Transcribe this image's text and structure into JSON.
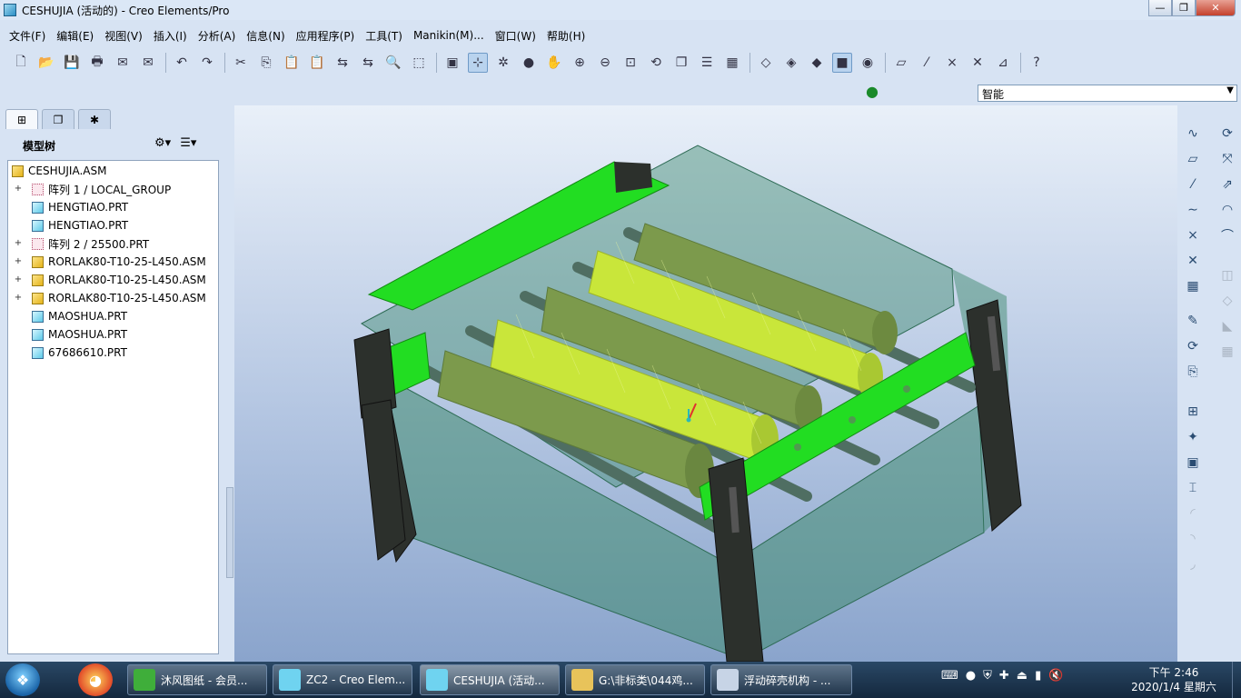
{
  "window": {
    "title": "CESHUJIA (活动的) - Creo Elements/Pro",
    "controls": {
      "minimize": "—",
      "maximize": "❐",
      "close": "✕"
    }
  },
  "menu": [
    "文件(F)",
    "编辑(E)",
    "视图(V)",
    "插入(I)",
    "分析(A)",
    "信息(N)",
    "应用程序(P)",
    "工具(T)",
    "Manikin(M)...",
    "窗口(W)",
    "帮助(H)"
  ],
  "toolbar": {
    "icons": [
      "new-icon",
      "open-icon",
      "save-icon",
      "print-icon",
      "email-icon",
      "mail-attach-icon",
      "|",
      "undo-icon",
      "redo-icon",
      "|",
      "cut-icon",
      "copy-icon",
      "paste-icon",
      "paste-special-icon",
      "regenerate-icon",
      "regen-manager-icon",
      "find-icon",
      "select-box-icon",
      "|",
      "repaint-icon",
      "spin-center-icon",
      "orient-mode-icon",
      "appearance-icon",
      "pan-icon",
      "zoom-in-icon",
      "zoom-out-icon",
      "refit-icon",
      "reorient-icon",
      "saved-views-icon",
      "layers-icon",
      "view-manager-icon",
      "|",
      "wireframe-icon",
      "hidden-line-icon",
      "no-hidden-icon",
      "shading-icon",
      "enhanced-realism-icon",
      "|",
      "datum-plane-icon",
      "datum-axis-icon",
      "datum-point-icon",
      "csys-icon",
      "annotation-icon",
      "|",
      "context-help-icon"
    ],
    "active": [
      "spin-center-icon",
      "shading-icon"
    ]
  },
  "filter": {
    "value": "智能"
  },
  "panel": {
    "tabs": [
      "model-tree-tab",
      "folder-browser-tab",
      "favorites-tab"
    ],
    "title": "模型树"
  },
  "tree": [
    {
      "label": "CESHUJIA.ASM",
      "type": "asm",
      "level": 0,
      "expandable": false
    },
    {
      "label": "阵列 1 / LOCAL_GROUP",
      "type": "grp",
      "level": 1,
      "expandable": true
    },
    {
      "label": "HENGTIAO.PRT",
      "type": "prt",
      "level": 1,
      "expandable": false
    },
    {
      "label": "HENGTIAO.PRT",
      "type": "prt",
      "level": 1,
      "expandable": false
    },
    {
      "label": "阵列 2 / 25500.PRT",
      "type": "grp",
      "level": 1,
      "expandable": true
    },
    {
      "label": "RORLAK80-T10-25-L450.ASM",
      "type": "asm",
      "level": 1,
      "expandable": true
    },
    {
      "label": "RORLAK80-T10-25-L450.ASM",
      "type": "asm",
      "level": 1,
      "expandable": true
    },
    {
      "label": "RORLAK80-T10-25-L450.ASM",
      "type": "asm",
      "level": 1,
      "expandable": true
    },
    {
      "label": "MAOSHUA.PRT",
      "type": "prt",
      "level": 1,
      "expandable": false
    },
    {
      "label": "MAOSHUA.PRT",
      "type": "prt",
      "level": 1,
      "expandable": false
    },
    {
      "label": "67686610.PRT",
      "type": "prt",
      "level": 1,
      "expandable": false
    }
  ],
  "taskbar": {
    "tasks": [
      {
        "label": "沐风图纸 - 会员...",
        "color": "#3fae3a"
      },
      {
        "label": "ZC2 - Creo Elem...",
        "color": "#6fd3f0"
      },
      {
        "label": "CESHUJIA (活动...",
        "color": "#6fd3f0",
        "active": true
      },
      {
        "label": "G:\\非标类\\044鸡...",
        "color": "#e8c35a"
      },
      {
        "label": "浮动碎壳机构 - ...",
        "color": "#c7d4e6"
      }
    ],
    "clock_time": "下午 2:46",
    "clock_date": "2020/1/4 星期六"
  },
  "colors": {
    "green_frame": "#22dd22",
    "leg": "#2c302c",
    "roller_bright": "#c9e63a",
    "roller_dull": "#7c9a4c",
    "housing": "#3f8a6f"
  }
}
